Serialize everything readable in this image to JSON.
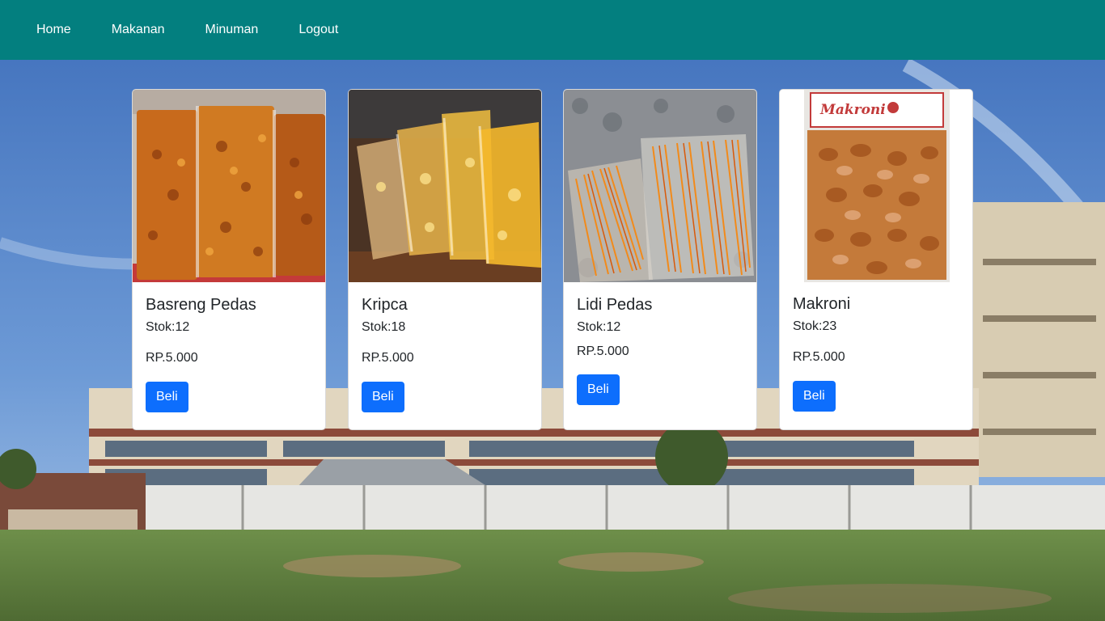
{
  "nav": {
    "items": [
      "Home",
      "Makanan",
      "Minuman",
      "Logout"
    ]
  },
  "colors": {
    "navbar": "#037f7f",
    "button": "#0d6efd",
    "sky": "#4a7fc1",
    "grass": "#5d7a3e"
  },
  "products": [
    {
      "name": "Basreng Pedas",
      "stock": "Stok:12",
      "price": "RP.5.000",
      "button": "Beli",
      "image": "basreng-photo"
    },
    {
      "name": "Kripca",
      "stock": "Stok:18",
      "price": "RP.5.000",
      "button": "Beli",
      "image": "kripca-photo"
    },
    {
      "name": "Lidi Pedas",
      "stock": "Stok:12",
      "price": "RP.5.000",
      "button": "Beli",
      "image": "lidi-photo"
    },
    {
      "name": "Makroni",
      "stock": "Stok:23",
      "price": "RP.5.000",
      "button": "Beli",
      "image": "makroni-photo"
    }
  ],
  "makroni_label": "Makroni"
}
